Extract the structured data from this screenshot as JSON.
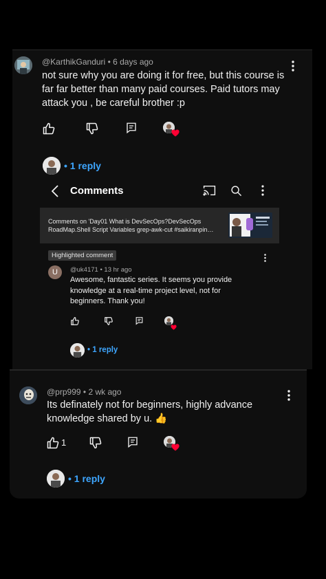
{
  "comment1": {
    "author": "@KarthikGanduri",
    "time": "6 days ago",
    "lines": [
      "not sure why you are doing it for free, but this course is",
      "far far better than many paid courses. Paid tutors may",
      "attack you , be careful brother  :p"
    ],
    "reply_label": "1 reply"
  },
  "embed": {
    "header_title": "Comments",
    "video_lines": [
      "Comments on 'Day01 What is DevSecOps?DevSecOps",
      "RoadMap.Shell Script Variables grep-awk-cut #saikiranpin…"
    ],
    "highlight_badge": "Highlighted comment",
    "comment": {
      "avatar_letter": "U",
      "author": "@uk4171",
      "time": "13 hr ago",
      "lines": [
        "Awesome, fantastic series. It seems you provide",
        "knowledge at a real-time project level, not for",
        "beginners. Thank you!"
      ]
    },
    "reply_label": "1 reply"
  },
  "comment2": {
    "author": "@prp999",
    "time": "2 wk ago",
    "lines": [
      "Its definately not for beginners, highly advance",
      "knowledge shared by u. 👍"
    ],
    "like_count": "1",
    "reply_label": "1 reply"
  },
  "colors": {
    "link_blue": "#3ea6ff",
    "heart_red": "#ff0033",
    "panel": "#0f0f0f"
  },
  "icons": [
    "like-icon",
    "dislike-icon",
    "reply-icon",
    "more-vert-icon",
    "cast-icon",
    "search-icon",
    "back-icon",
    "heart-icon"
  ]
}
